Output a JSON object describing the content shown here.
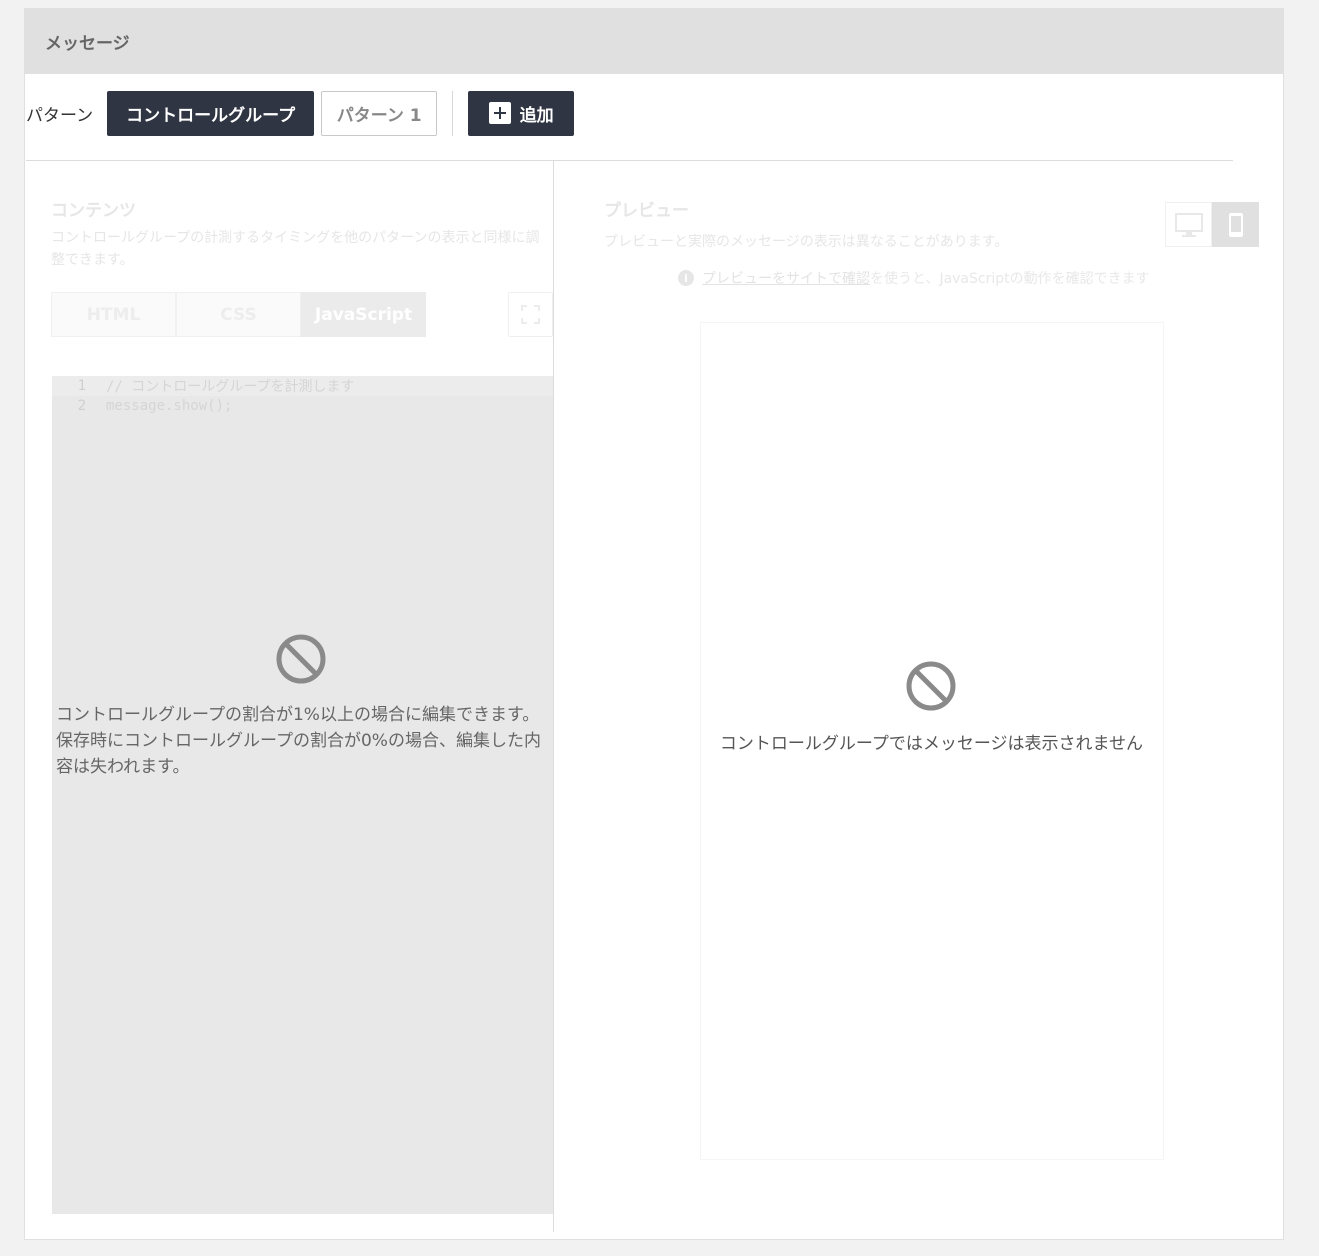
{
  "panel": {
    "title": "メッセージ"
  },
  "patterns": {
    "label": "パターン",
    "control_group": "コントロールグループ",
    "pattern1": "パターン 1",
    "add": "追加"
  },
  "contents": {
    "title": "コンテンツ",
    "description": "コントロールグループの計測するタイミングを他のパターンの表示と同様に調整できます。",
    "tabs": [
      "HTML",
      "CSS",
      "JavaScript"
    ],
    "active_tab": "JavaScript",
    "code_lines": [
      {
        "number": "1",
        "text": "// コントロールグループを計測します"
      },
      {
        "number": "2",
        "text": "message.show();"
      }
    ],
    "disabled_message": "コントロールグループの割合が1%以上の場合に編集できます。保存時にコントロールグループの割合が0%の場合、編集した内容は失われます。"
  },
  "preview": {
    "title": "プレビュー",
    "description": "プレビューと実際のメッセージの表示は異なることがあります。",
    "note_link": "プレビューをサイトで確認",
    "note_rest": " を使うと、JavaScriptの動作を確認できます",
    "disabled_message": "コントロールグループではメッセージは表示されません"
  }
}
